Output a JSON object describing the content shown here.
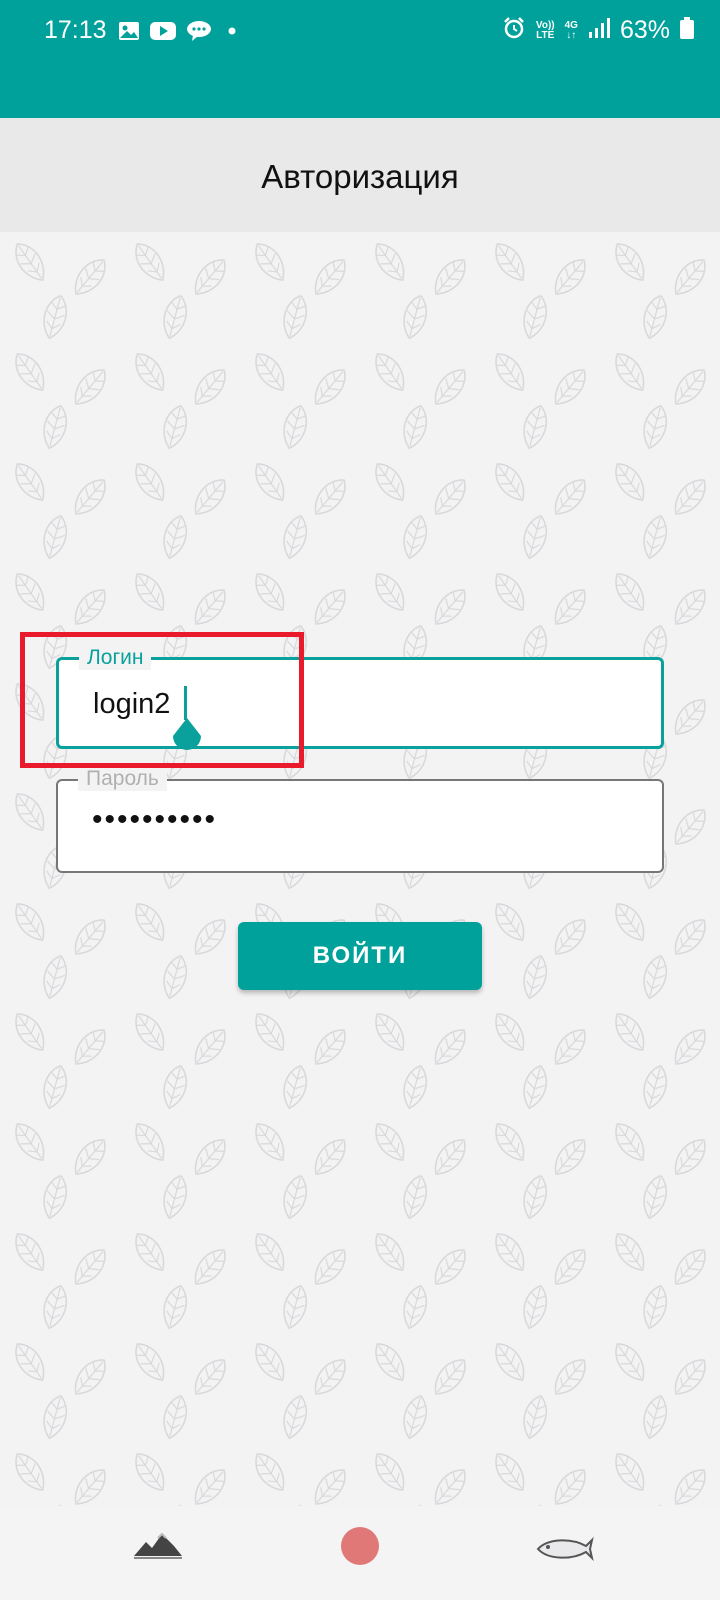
{
  "status_bar": {
    "time": "17:13",
    "notification_icons": [
      "gallery-icon",
      "youtube-icon",
      "messages-icon",
      "more-dot-icon"
    ],
    "right_icons": [
      "alarm-icon",
      "volte-icon",
      "4g-icon",
      "signal-icon"
    ],
    "volte_label_top": "Vo))",
    "volte_label_bottom": "LTE",
    "network_label": "4G",
    "battery_percent": "63%",
    "color": "#00a19b"
  },
  "app_bar": {
    "title": "Авторизация"
  },
  "form": {
    "login": {
      "label": "Логин",
      "value": "login2",
      "focused": true
    },
    "password": {
      "label": "Пароль",
      "value": "••••••••••"
    },
    "submit_label": "ВОЙТИ"
  },
  "nav_bar": {
    "items": [
      "landscape-icon",
      "home-circle-icon",
      "back-fish-icon"
    ]
  },
  "colors": {
    "accent": "#00a19b",
    "highlight": "#e81a2b"
  }
}
